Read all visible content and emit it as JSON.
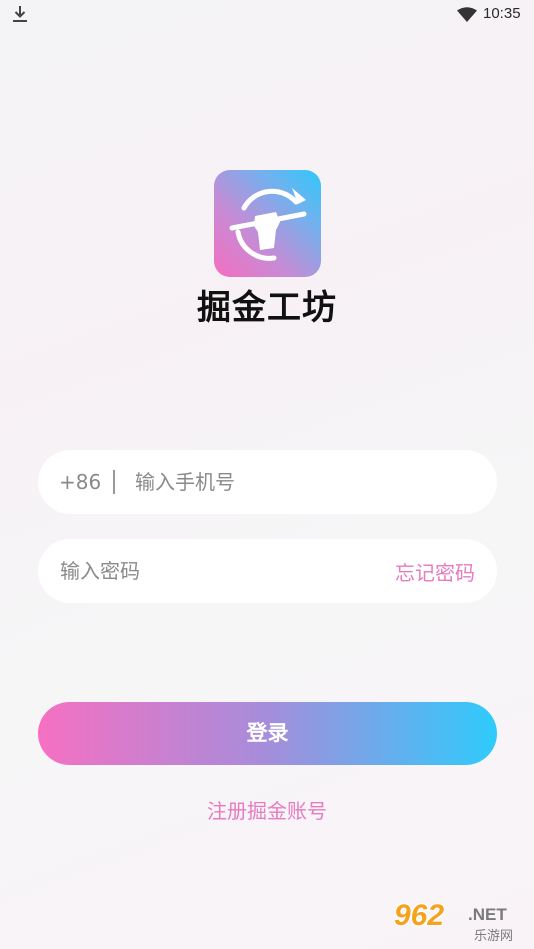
{
  "status_bar": {
    "time": "10:35",
    "left_icon": "download-icon",
    "right_icon": "wifi-icon"
  },
  "app": {
    "name": "掘金工坊",
    "logo_icon": "pickaxe-fist-logo",
    "logo_colors": [
      "#f46ec0",
      "#2fc8f9"
    ]
  },
  "login_form": {
    "country_code": "+86",
    "phone_placeholder": "输入手机号",
    "password_placeholder": "输入密码",
    "forgot_password_label": "忘记密码",
    "login_label": "登录",
    "register_label": "注册掘金账号"
  },
  "colors": {
    "accent_pink": "#e67bbf",
    "button_gradient_start": "#f670c2",
    "button_gradient_end": "#2fcbfc"
  },
  "watermark": {
    "number": "962",
    "suffix": ".NET",
    "text_cn": "乐游网"
  }
}
